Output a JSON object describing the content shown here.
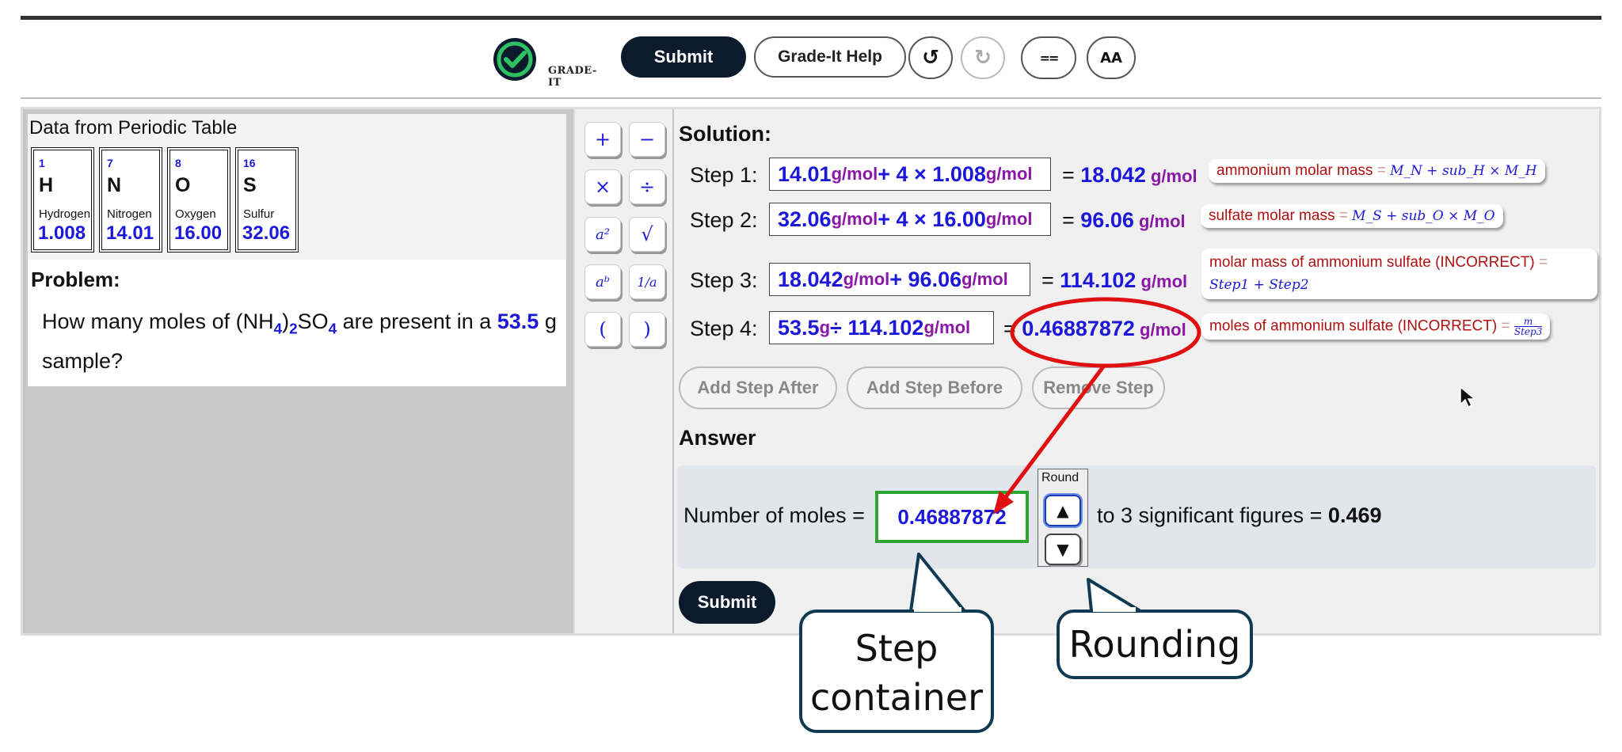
{
  "toolbar": {
    "logo_text": "GRADE-IT",
    "submit_label": "Submit",
    "help_label": "Grade-It Help",
    "undo_icon": "↺",
    "redo_icon": "↻",
    "equals_icon": "==",
    "font_icon": "AA"
  },
  "periodic_table": {
    "title": "Data from Periodic Table",
    "elements": [
      {
        "number": "1",
        "symbol": "H",
        "name": "Hydrogen",
        "mass": "1.008"
      },
      {
        "number": "7",
        "symbol": "N",
        "name": "Nitrogen",
        "mass": "14.01"
      },
      {
        "number": "8",
        "symbol": "O",
        "name": "Oxygen",
        "mass": "16.00"
      },
      {
        "number": "16",
        "symbol": "S",
        "name": "Sulfur",
        "mass": "32.06"
      }
    ]
  },
  "problem": {
    "title": "Problem:",
    "text_before": "How many moles of (NH",
    "sub1": "4",
    "paren": ")",
    "sub2": "2",
    "so": "SO",
    "sub3": "4",
    "text_mid": " are present in a ",
    "value": "53.5",
    "text_after": " g sample?"
  },
  "keypad": {
    "keys": [
      "+",
      "−",
      "×",
      "÷",
      "a²",
      "√",
      "aᵇ",
      "1/a",
      "(",
      ")"
    ]
  },
  "solution": {
    "title": "Solution:",
    "steps": [
      {
        "label": "Step 1:",
        "expr": [
          {
            "v": "14.01"
          },
          {
            "u": " g/mol"
          },
          {
            "v": " + 4 × 1.008"
          },
          {
            "u": " g/mol"
          }
        ],
        "eq": "= ",
        "result": "18.042",
        "result_unit": " g/mol",
        "tag_text": "ammonium molar mass",
        "tag_formula": "M_N + sub_H × M_H"
      },
      {
        "label": "Step 2:",
        "expr": [
          {
            "v": "32.06"
          },
          {
            "u": " g/mol"
          },
          {
            "v": " + 4 × 16.00"
          },
          {
            "u": " g/mol"
          }
        ],
        "eq": "= ",
        "result": "96.06",
        "result_unit": " g/mol",
        "tag_text": "sulfate molar mass",
        "tag_formula": "M_S + sub_O × M_O"
      },
      {
        "label": "Step 3:",
        "expr": [
          {
            "v": "18.042"
          },
          {
            "u": " g/mol"
          },
          {
            "v": " + 96.06"
          },
          {
            "u": " g/mol"
          }
        ],
        "eq": "= ",
        "result": "114.102",
        "result_unit": " g/mol",
        "tag_text": "molar mass of ammonium sulfate (INCORRECT)",
        "tag_formula": "Step1 + Step2"
      },
      {
        "label": "Step 4:",
        "expr": [
          {
            "v": "53.5"
          },
          {
            "u": " g"
          },
          {
            "v": " ÷ 114.102"
          },
          {
            "u": " g/mol"
          }
        ],
        "eq": "= ",
        "result": "0.46887872",
        "result_unit": " g/mol",
        "tag_text": "moles of ammonium sulfate (INCORRECT)",
        "tag_formula_num": "m",
        "tag_formula_den": "Step3"
      }
    ],
    "add_after_label": "Add Step After",
    "add_before_label": "Add Step Before",
    "remove_label": "Remove Step"
  },
  "answer": {
    "title": "Answer",
    "label": "Number of moles =",
    "value": "0.46887872",
    "round_label": "Round",
    "round_up": "▲",
    "round_down": "▼",
    "sig_text": "to 3 significant figures = ",
    "sig_value": "0.469",
    "submit_label": "Submit"
  },
  "callouts": {
    "step_container": [
      "Step",
      "container"
    ],
    "rounding": "Rounding"
  },
  "colors": {
    "accent_blue": "#1b18d9",
    "unit_purple": "#8b17a6",
    "tag_red": "#b01010",
    "highlight_red": "#e01010",
    "answer_green": "#2aa631",
    "dark_button": "#0b1a2c"
  }
}
